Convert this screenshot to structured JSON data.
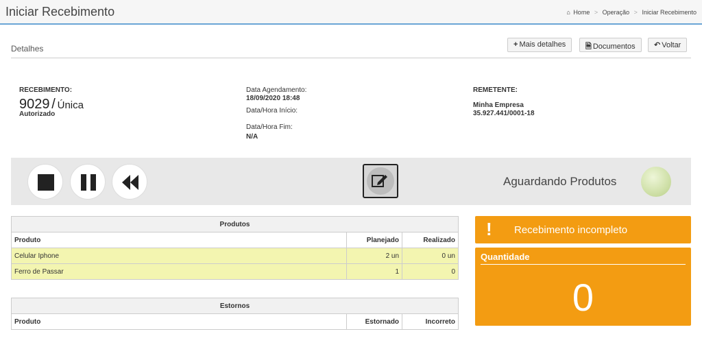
{
  "header": {
    "title": "Iniciar Recebimento",
    "breadcrumb": [
      "Home",
      "Operação",
      "Iniciar Recebimento"
    ]
  },
  "panel": {
    "title": "Detalhes",
    "buttons": {
      "more": "Mais detalhes",
      "docs": "Documentos",
      "back": "Voltar"
    }
  },
  "receipt": {
    "label": "RECEBIMENTO:",
    "number": "9029",
    "separator": "/",
    "type": "Única",
    "status": "Autorizado"
  },
  "dates": {
    "scheduled_label": "Data Agendamento:",
    "scheduled_value": "18/09/2020 18:48",
    "start_label": "Data/Hora Início:",
    "end_label": "Data/Hora Fim:",
    "end_value": "N/A"
  },
  "sender": {
    "label": "REMETENTE:",
    "name": "Minha Empresa",
    "doc": "35.927.441/0001-18"
  },
  "controls": {
    "status_text": "Aguardando Produtos",
    "status_color": "#cfe0a8"
  },
  "products": {
    "caption": "Produtos",
    "columns": [
      "Produto",
      "Planejado",
      "Realizado"
    ],
    "rows": [
      [
        "Celular Iphone",
        "2 un",
        "0 un"
      ],
      [
        "Ferro de Passar",
        "1",
        "0"
      ]
    ]
  },
  "returns": {
    "caption": "Estornos",
    "columns": [
      "Produto",
      "Estornado",
      "Incorreto"
    ]
  },
  "alert": {
    "icon": "!",
    "text": "Recebimento incompleto",
    "color": "#f39c12"
  },
  "quantity": {
    "label": "Quantidade",
    "value": "0"
  }
}
